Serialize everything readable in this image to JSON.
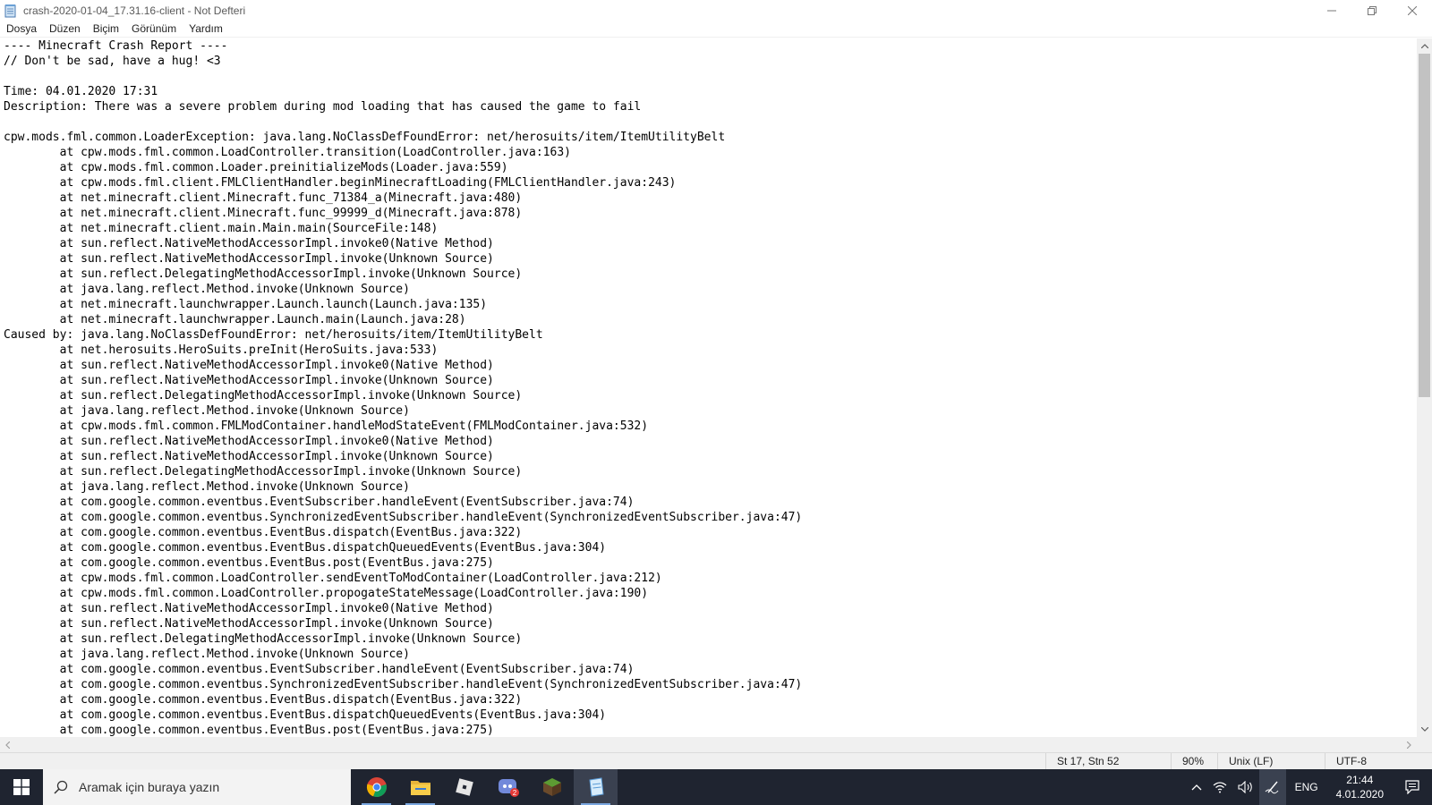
{
  "window": {
    "title": "crash-2020-01-04_17.31.16-client - Not Defteri"
  },
  "menu": {
    "items": [
      "Dosya",
      "Düzen",
      "Biçim",
      "Görünüm",
      "Yardım"
    ]
  },
  "editor": {
    "lines": [
      "---- Minecraft Crash Report ----",
      "// Don't be sad, have a hug! <3",
      "",
      "Time: 04.01.2020 17:31",
      "Description: There was a severe problem during mod loading that has caused the game to fail",
      "",
      "cpw.mods.fml.common.LoaderException: java.lang.NoClassDefFoundError: net/herosuits/item/ItemUtilityBelt",
      "\tat cpw.mods.fml.common.LoadController.transition(LoadController.java:163)",
      "\tat cpw.mods.fml.common.Loader.preinitializeMods(Loader.java:559)",
      "\tat cpw.mods.fml.client.FMLClientHandler.beginMinecraftLoading(FMLClientHandler.java:243)",
      "\tat net.minecraft.client.Minecraft.func_71384_a(Minecraft.java:480)",
      "\tat net.minecraft.client.Minecraft.func_99999_d(Minecraft.java:878)",
      "\tat net.minecraft.client.main.Main.main(SourceFile:148)",
      "\tat sun.reflect.NativeMethodAccessorImpl.invoke0(Native Method)",
      "\tat sun.reflect.NativeMethodAccessorImpl.invoke(Unknown Source)",
      "\tat sun.reflect.DelegatingMethodAccessorImpl.invoke(Unknown Source)",
      "\tat java.lang.reflect.Method.invoke(Unknown Source)",
      "\tat net.minecraft.launchwrapper.Launch.launch(Launch.java:135)",
      "\tat net.minecraft.launchwrapper.Launch.main(Launch.java:28)",
      "Caused by: java.lang.NoClassDefFoundError: net/herosuits/item/ItemUtilityBelt",
      "\tat net.herosuits.HeroSuits.preInit(HeroSuits.java:533)",
      "\tat sun.reflect.NativeMethodAccessorImpl.invoke0(Native Method)",
      "\tat sun.reflect.NativeMethodAccessorImpl.invoke(Unknown Source)",
      "\tat sun.reflect.DelegatingMethodAccessorImpl.invoke(Unknown Source)",
      "\tat java.lang.reflect.Method.invoke(Unknown Source)",
      "\tat cpw.mods.fml.common.FMLModContainer.handleModStateEvent(FMLModContainer.java:532)",
      "\tat sun.reflect.NativeMethodAccessorImpl.invoke0(Native Method)",
      "\tat sun.reflect.NativeMethodAccessorImpl.invoke(Unknown Source)",
      "\tat sun.reflect.DelegatingMethodAccessorImpl.invoke(Unknown Source)",
      "\tat java.lang.reflect.Method.invoke(Unknown Source)",
      "\tat com.google.common.eventbus.EventSubscriber.handleEvent(EventSubscriber.java:74)",
      "\tat com.google.common.eventbus.SynchronizedEventSubscriber.handleEvent(SynchronizedEventSubscriber.java:47)",
      "\tat com.google.common.eventbus.EventBus.dispatch(EventBus.java:322)",
      "\tat com.google.common.eventbus.EventBus.dispatchQueuedEvents(EventBus.java:304)",
      "\tat com.google.common.eventbus.EventBus.post(EventBus.java:275)",
      "\tat cpw.mods.fml.common.LoadController.sendEventToModContainer(LoadController.java:212)",
      "\tat cpw.mods.fml.common.LoadController.propogateStateMessage(LoadController.java:190)",
      "\tat sun.reflect.NativeMethodAccessorImpl.invoke0(Native Method)",
      "\tat sun.reflect.NativeMethodAccessorImpl.invoke(Unknown Source)",
      "\tat sun.reflect.DelegatingMethodAccessorImpl.invoke(Unknown Source)",
      "\tat java.lang.reflect.Method.invoke(Unknown Source)",
      "\tat com.google.common.eventbus.EventSubscriber.handleEvent(EventSubscriber.java:74)",
      "\tat com.google.common.eventbus.SynchronizedEventSubscriber.handleEvent(SynchronizedEventSubscriber.java:47)",
      "\tat com.google.common.eventbus.EventBus.dispatch(EventBus.java:322)",
      "\tat com.google.common.eventbus.EventBus.dispatchQueuedEvents(EventBus.java:304)",
      "\tat com.google.common.eventbus.EventBus.post(EventBus.java:275)"
    ]
  },
  "statusbar": {
    "position": "St 17, Stn 52",
    "zoom": "90%",
    "line_ending": "Unix (LF)",
    "encoding": "UTF-8"
  },
  "taskbar": {
    "search_placeholder": "Aramak için buraya yazın",
    "apps": [
      {
        "name": "chrome",
        "icon": "chrome-icon"
      },
      {
        "name": "file-explorer",
        "icon": "folder-icon"
      },
      {
        "name": "roblox",
        "icon": "roblox-icon"
      },
      {
        "name": "discord",
        "icon": "discord-icon",
        "badge": "2"
      },
      {
        "name": "minecraft",
        "icon": "minecraft-icon"
      },
      {
        "name": "notepad",
        "icon": "notepad-icon"
      }
    ],
    "tray": {
      "language": "ENG",
      "time": "21:44",
      "date": "4.01.2020"
    }
  },
  "colors": {
    "taskbar_bg": "#1f2430",
    "statusbar_bg": "#f0f0f0",
    "scroll_thumb": "#c2c2c2"
  }
}
